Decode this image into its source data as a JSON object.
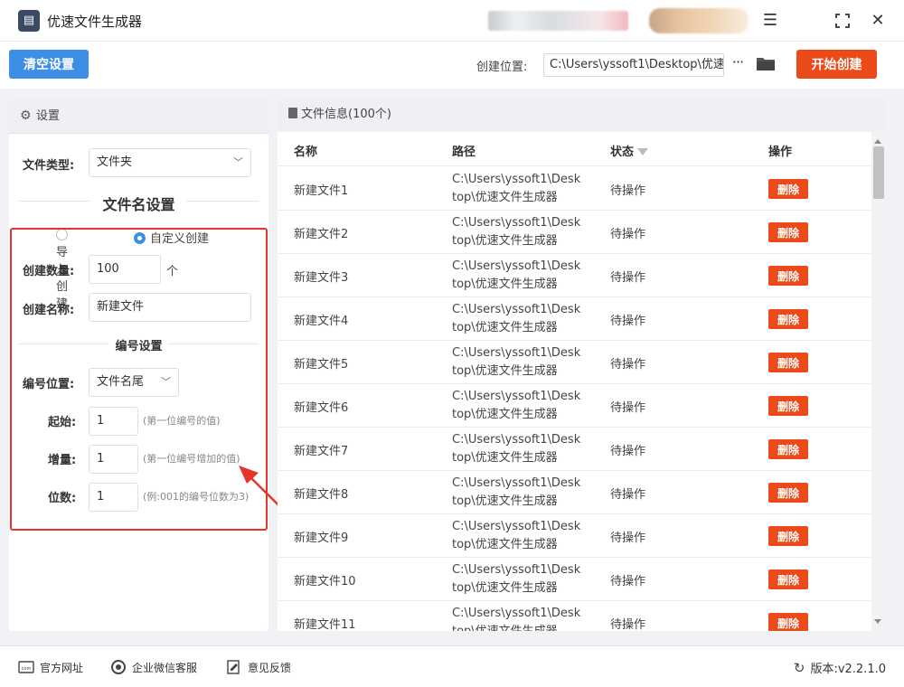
{
  "app": {
    "title": "优速文件生成器"
  },
  "toolbar": {
    "clear_label": "清空设置",
    "path_label": "创建位置:",
    "path_value": "C:\\Users\\yssoft1\\Desktop\\优速",
    "dots": "···",
    "start_label": "开始创建"
  },
  "settings": {
    "header": "设置",
    "file_type_label": "文件类型:",
    "file_type_value": "文件夹",
    "name_section_title": "文件名设置",
    "radio_import": "导入创建",
    "radio_custom": "自定义创建",
    "radio_selected": "自定义创建",
    "count_label": "创建数量:",
    "count_value": "100",
    "count_unit": "个",
    "name_label": "创建名称:",
    "name_value": "新建文件",
    "number_section_title": "编号设置",
    "pos_label": "编号位置:",
    "pos_value": "文件名尾",
    "start_label": "起始:",
    "start_value": "1",
    "start_hint": "(第一位编号的值)",
    "step_label": "增量:",
    "step_value": "1",
    "step_hint": "(第一位编号增加的值)",
    "digits_label": "位数:",
    "digits_value": "1",
    "digits_hint": "(例:001的编号位数为3)"
  },
  "file_info": {
    "header": "文件信息(100个)",
    "columns": {
      "name": "名称",
      "path": "路径",
      "status": "状态",
      "action": "操作"
    },
    "rows": [
      {
        "name": "新建文件1",
        "path1": "C:\\Users\\yssoft1\\Desk",
        "path2": "top\\优速文件生成器",
        "status": "待操作",
        "action": "删除"
      },
      {
        "name": "新建文件2",
        "path1": "C:\\Users\\yssoft1\\Desk",
        "path2": "top\\优速文件生成器",
        "status": "待操作",
        "action": "删除"
      },
      {
        "name": "新建文件3",
        "path1": "C:\\Users\\yssoft1\\Desk",
        "path2": "top\\优速文件生成器",
        "status": "待操作",
        "action": "删除"
      },
      {
        "name": "新建文件4",
        "path1": "C:\\Users\\yssoft1\\Desk",
        "path2": "top\\优速文件生成器",
        "status": "待操作",
        "action": "删除"
      },
      {
        "name": "新建文件5",
        "path1": "C:\\Users\\yssoft1\\Desk",
        "path2": "top\\优速文件生成器",
        "status": "待操作",
        "action": "删除"
      },
      {
        "name": "新建文件6",
        "path1": "C:\\Users\\yssoft1\\Desk",
        "path2": "top\\优速文件生成器",
        "status": "待操作",
        "action": "删除"
      },
      {
        "name": "新建文件7",
        "path1": "C:\\Users\\yssoft1\\Desk",
        "path2": "top\\优速文件生成器",
        "status": "待操作",
        "action": "删除"
      },
      {
        "name": "新建文件8",
        "path1": "C:\\Users\\yssoft1\\Desk",
        "path2": "top\\优速文件生成器",
        "status": "待操作",
        "action": "删除"
      },
      {
        "name": "新建文件9",
        "path1": "C:\\Users\\yssoft1\\Desk",
        "path2": "top\\优速文件生成器",
        "status": "待操作",
        "action": "删除"
      },
      {
        "name": "新建文件10",
        "path1": "C:\\Users\\yssoft1\\Desk",
        "path2": "top\\优速文件生成器",
        "status": "待操作",
        "action": "删除"
      },
      {
        "name": "新建文件11",
        "path1": "C:\\Users\\yssoft1\\Desk",
        "path2": "top\\优速文件生成器",
        "status": "待操作",
        "action": "删除"
      }
    ]
  },
  "footer": {
    "website": "官方网址",
    "wechat": "企业微信客服",
    "feedback": "意见反馈",
    "version": "版本:v2.2.1.0"
  },
  "colors": {
    "primary_blue": "#3d8fe6",
    "accent_orange": "#ec4a19",
    "highlight_red": "#e8332a"
  }
}
